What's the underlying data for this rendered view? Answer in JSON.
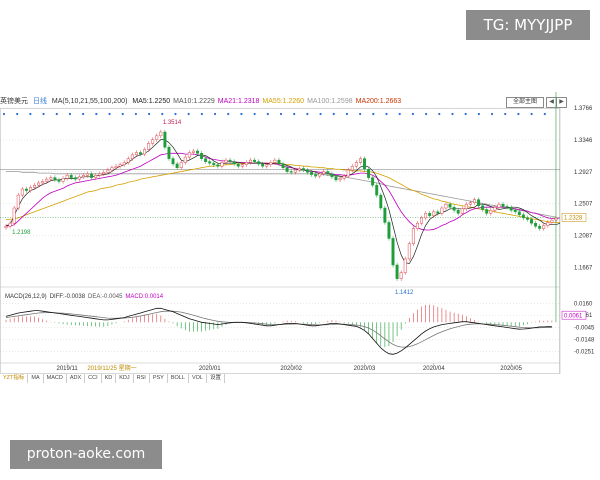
{
  "watermarks": {
    "top_right": "TG: MYYJJPP",
    "bottom_left": "proton-aoke.com"
  },
  "header": {
    "symbol": "英镑美元",
    "period": "日线",
    "ma_params": "MA(5,10,21,55,100,200)",
    "ma_values": [
      {
        "label": "MA5:1.2250",
        "color": "#222222"
      },
      {
        "label": "MA10:1.2229",
        "color": "#555555"
      },
      {
        "label": "MA21:1.2318",
        "color": "#c000c0"
      },
      {
        "label": "MA55:1.2260",
        "color": "#d4a000"
      },
      {
        "label": "MA100:1.2598",
        "color": "#999999"
      },
      {
        "label": "MA200:1.2663",
        "color": "#cc3300"
      }
    ],
    "zoom_label": "全部主图"
  },
  "macd_header": {
    "params": "MACD(26,12,9)",
    "diff": "DIFF:-0.0038",
    "dea": "DEA:-0.0045",
    "macd": "MACD:0.0014"
  },
  "colors": {
    "up": "#e0454b",
    "down": "#1e9e3a",
    "grid": "#c8c8c8",
    "ma5": "#222222",
    "ma21": "#c000c0",
    "ma55": "#d4a000",
    "ma100": "#999999",
    "ma200": "#cc3300"
  },
  "tabs": [
    "YZT指标",
    "MA",
    "MACD",
    "ADX",
    "CCI",
    "KD",
    "KDJ",
    "RSI",
    "PSY",
    "BOLL",
    "VOL",
    "设置"
  ],
  "chart_data": {
    "type": "candlestick",
    "price_axis_ticks": [
      "1.3766",
      "1.3346",
      "1.2927",
      "1.2507",
      "1.2087",
      "1.1667"
    ],
    "price_range": [
      1.145,
      1.3766
    ],
    "current_price_label": "1.2328",
    "current_price": 1.2328,
    "annotations": [
      {
        "text": "1.3514",
        "value": 1.3514,
        "index": 38
      },
      {
        "text": "1.2198",
        "value": 1.2198,
        "index": 1
      },
      {
        "text": "1.1412",
        "value": 1.1412,
        "index": 95
      }
    ],
    "x_labels": [
      "2019/11",
      "2020/01",
      "2020/02",
      "2020/03",
      "2020/04",
      "2020/05"
    ],
    "x_label_index": [
      15,
      50,
      70,
      88,
      105,
      124
    ],
    "crosshair_label": "2019/11/25 星期一",
    "closes": [
      1.221,
      1.225,
      1.245,
      1.262,
      1.27,
      1.268,
      1.272,
      1.275,
      1.278,
      1.28,
      1.283,
      1.285,
      1.282,
      1.28,
      1.284,
      1.288,
      1.285,
      1.283,
      1.286,
      1.288,
      1.29,
      1.285,
      1.288,
      1.29,
      1.292,
      1.295,
      1.298,
      1.3,
      1.302,
      1.305,
      1.31,
      1.315,
      1.318,
      1.316,
      1.322,
      1.33,
      1.335,
      1.34,
      1.345,
      1.325,
      1.31,
      1.303,
      1.298,
      1.305,
      1.312,
      1.318,
      1.32,
      1.317,
      1.31,
      1.306,
      1.304,
      1.302,
      1.3,
      1.305,
      1.308,
      1.306,
      1.303,
      1.3,
      1.302,
      1.305,
      1.308,
      1.306,
      1.303,
      1.3,
      1.302,
      1.305,
      1.308,
      1.303,
      1.298,
      1.293,
      1.292,
      1.295,
      1.297,
      1.295,
      1.292,
      1.289,
      1.287,
      1.29,
      1.293,
      1.29,
      1.286,
      1.282,
      1.284,
      1.287,
      1.295,
      1.3,
      1.305,
      1.31,
      1.296,
      1.285,
      1.275,
      1.262,
      1.245,
      1.226,
      1.205,
      1.17,
      1.152,
      1.16,
      1.178,
      1.198,
      1.218,
      1.225,
      1.232,
      1.238,
      1.235,
      1.24,
      1.238,
      1.245,
      1.25,
      1.246,
      1.242,
      1.238,
      1.244,
      1.25,
      1.252,
      1.256,
      1.248,
      1.243,
      1.238,
      1.242,
      1.246,
      1.25,
      1.247,
      1.246,
      1.242,
      1.24,
      1.236,
      1.232,
      1.23,
      1.225,
      1.221,
      1.218,
      1.222,
      1.226,
      1.229,
      1.232
    ],
    "ma5": [
      1.222,
      1.223,
      1.235,
      1.247,
      1.257,
      1.263,
      1.268,
      1.27,
      1.273,
      1.276,
      1.278,
      1.281,
      1.282,
      1.282,
      1.283,
      1.284,
      1.284,
      1.284,
      1.285,
      1.286,
      1.286,
      1.286,
      1.287,
      1.288,
      1.289,
      1.29,
      1.293,
      1.297,
      1.3,
      1.302,
      1.305,
      1.309,
      1.313,
      1.315,
      1.317,
      1.32,
      1.325,
      1.33,
      1.335,
      1.335,
      1.331,
      1.325,
      1.317,
      1.308,
      1.306,
      1.308,
      1.311,
      1.314,
      1.315,
      1.314,
      1.311,
      1.307,
      1.304,
      1.303,
      1.304,
      1.304,
      1.304,
      1.305,
      1.304,
      1.304,
      1.304,
      1.304,
      1.305,
      1.304,
      1.303,
      1.303,
      1.304,
      1.304,
      1.303,
      1.301,
      1.299,
      1.296,
      1.295,
      1.295,
      1.294,
      1.294,
      1.292,
      1.29,
      1.29,
      1.29,
      1.289,
      1.288,
      1.287,
      1.286,
      1.288,
      1.29,
      1.294,
      1.299,
      1.301,
      1.299,
      1.294,
      1.286,
      1.273,
      1.259,
      1.243,
      1.222,
      1.2,
      1.183,
      1.173,
      1.172,
      1.181,
      1.195,
      1.21,
      1.222,
      1.23,
      1.234,
      1.237,
      1.239,
      1.241,
      1.244,
      1.244,
      1.244,
      1.244,
      1.244,
      1.245,
      1.246,
      1.25,
      1.25,
      1.249,
      1.247,
      1.245,
      1.243,
      1.244,
      1.245,
      1.246,
      1.246,
      1.245,
      1.243,
      1.239,
      1.235,
      1.232,
      1.229,
      1.225,
      1.223,
      1.223,
      1.223,
      1.225
    ],
    "ma21": [
      1.222,
      1.221,
      1.223,
      1.228,
      1.233,
      1.238,
      1.243,
      1.248,
      1.253,
      1.258,
      1.262,
      1.265,
      1.267,
      1.269,
      1.271,
      1.274,
      1.276,
      1.278,
      1.279,
      1.28,
      1.281,
      1.282,
      1.283,
      1.284,
      1.285,
      1.286,
      1.287,
      1.288,
      1.29,
      1.292,
      1.294,
      1.296,
      1.298,
      1.3,
      1.303,
      1.306,
      1.309,
      1.312,
      1.315,
      1.316,
      1.317,
      1.317,
      1.317,
      1.317,
      1.316,
      1.316,
      1.316,
      1.315,
      1.314,
      1.312,
      1.31,
      1.309,
      1.308,
      1.307,
      1.307,
      1.306,
      1.306,
      1.305,
      1.305,
      1.305,
      1.304,
      1.304,
      1.304,
      1.304,
      1.304,
      1.303,
      1.303,
      1.302,
      1.3,
      1.299,
      1.298,
      1.297,
      1.296,
      1.295,
      1.294,
      1.293,
      1.293,
      1.292,
      1.292,
      1.291,
      1.29,
      1.289,
      1.289,
      1.288,
      1.288,
      1.289,
      1.29,
      1.291,
      1.291,
      1.29,
      1.288,
      1.285,
      1.28,
      1.275,
      1.268,
      1.259,
      1.249,
      1.24,
      1.233,
      1.227,
      1.222,
      1.219,
      1.217,
      1.216,
      1.216,
      1.217,
      1.219,
      1.222,
      1.224,
      1.227,
      1.229,
      1.232,
      1.236,
      1.239,
      1.242,
      1.244,
      1.245,
      1.246,
      1.246,
      1.246,
      1.246,
      1.246,
      1.246,
      1.246,
      1.245,
      1.244,
      1.243,
      1.242,
      1.241,
      1.239,
      1.238,
      1.236,
      1.234,
      1.232,
      1.231,
      1.231,
      1.232
    ],
    "ma55": [
      1.23,
      1.23,
      1.231,
      1.232,
      1.234,
      1.236,
      1.238,
      1.24,
      1.242,
      1.244,
      1.246,
      1.248,
      1.25,
      1.252,
      1.254,
      1.256,
      1.258,
      1.26,
      1.262,
      1.264,
      1.266,
      1.267,
      1.268,
      1.27,
      1.271,
      1.272,
      1.273,
      1.275,
      1.276,
      1.277,
      1.279,
      1.28,
      1.281,
      1.283,
      1.284,
      1.285,
      1.286,
      1.287,
      1.288,
      1.289,
      1.29,
      1.291,
      1.292,
      1.293,
      1.294,
      1.295,
      1.296,
      1.297,
      1.298,
      1.299,
      1.3,
      1.3,
      1.301,
      1.301,
      1.302,
      1.302,
      1.303,
      1.303,
      1.303,
      1.304,
      1.304,
      1.304,
      1.304,
      1.304,
      1.304,
      1.304,
      1.304,
      1.303,
      1.303,
      1.302,
      1.302,
      1.301,
      1.301,
      1.3,
      1.3,
      1.299,
      1.299,
      1.298,
      1.298,
      1.297,
      1.297,
      1.296,
      1.296,
      1.295,
      1.295,
      1.294,
      1.294,
      1.294,
      1.293,
      1.293,
      1.292,
      1.291,
      1.289,
      1.287,
      1.285,
      1.282,
      1.279,
      1.276,
      1.273,
      1.27,
      1.268,
      1.266,
      1.263,
      1.261,
      1.259,
      1.257,
      1.256,
      1.254,
      1.253,
      1.251,
      1.25,
      1.249,
      1.248,
      1.247,
      1.246,
      1.245,
      1.244,
      1.243,
      1.242,
      1.241,
      1.24,
      1.239,
      1.238,
      1.237,
      1.236,
      1.235,
      1.234,
      1.233,
      1.232,
      1.231,
      1.23,
      1.229,
      1.228,
      1.227,
      1.226,
      1.226,
      1.226
    ],
    "ma200": [
      1.293,
      1.293,
      1.293,
      1.293,
      1.292,
      1.292,
      1.292,
      1.292,
      1.291,
      1.291,
      1.291,
      1.291,
      1.29,
      1.29,
      1.29,
      1.29,
      1.29,
      1.29,
      1.29,
      1.29,
      1.29,
      1.29,
      1.29,
      1.29,
      1.29,
      1.29,
      1.29,
      1.29,
      1.29,
      1.29,
      1.29,
      1.29,
      1.29,
      1.29,
      1.29,
      1.29,
      1.29,
      1.29,
      1.29,
      1.29,
      1.29,
      1.29,
      1.29,
      1.29,
      1.29,
      1.29,
      1.29,
      1.29,
      1.29,
      1.29,
      1.29,
      1.29,
      1.29,
      1.29,
      1.29,
      1.29,
      1.29,
      1.29,
      1.29,
      1.29,
      1.29,
      1.29,
      1.29,
      1.29,
      1.29,
      1.29,
      1.29,
      1.29,
      1.29,
      1.29,
      1.29,
      1.29,
      1.29,
      1.29,
      1.29,
      1.29,
      1.29,
      1.289,
      1.289,
      1.288,
      1.288,
      1.287,
      1.286,
      1.285,
      1.285,
      1.284,
      1.283,
      1.282,
      1.281,
      1.28,
      1.279,
      1.278,
      1.277,
      1.275,
      1.274,
      1.273,
      1.272,
      1.271,
      1.27,
      1.269,
      1.268,
      1.267,
      1.266,
      1.265,
      1.264,
      1.263,
      1.262,
      1.261,
      1.26,
      1.259,
      1.258,
      1.257,
      1.256,
      1.255,
      1.254,
      1.253,
      1.252,
      1.251,
      1.25,
      1.249,
      1.248,
      1.247,
      1.246,
      1.245,
      1.244,
      1.243,
      1.242,
      1.241,
      1.24,
      1.239,
      1.238,
      1.237,
      1.236,
      1.235,
      1.234,
      1.233
    ],
    "macd_axis_ticks": [
      "0.0160",
      "0.0061",
      "-0.0045",
      "-0.0148",
      "-0.0251"
    ],
    "macd_range": [
      -0.029,
      0.02
    ],
    "macd_current_label": "0.0061",
    "macd_current": 0.0061,
    "diff": [
      0.005,
      0.006,
      0.007,
      0.008,
      0.0085,
      0.009,
      0.0095,
      0.01,
      0.01,
      0.0095,
      0.009,
      0.0085,
      0.008,
      0.0075,
      0.007,
      0.0065,
      0.006,
      0.0055,
      0.005,
      0.0045,
      0.004,
      0.0035,
      0.003,
      0.0025,
      0.002,
      0.002,
      0.0025,
      0.003,
      0.0035,
      0.004,
      0.005,
      0.006,
      0.007,
      0.008,
      0.009,
      0.01,
      0.011,
      0.012,
      0.012,
      0.011,
      0.01,
      0.009,
      0.0075,
      0.006,
      0.0045,
      0.003,
      0.002,
      0.001,
      0.0,
      -0.0005,
      -0.001,
      -0.0015,
      -0.002,
      -0.0015,
      -0.001,
      -0.0005,
      0.0,
      0.0,
      0.0,
      -0.0005,
      -0.001,
      -0.0015,
      -0.002,
      -0.0025,
      -0.003,
      -0.003,
      -0.0025,
      -0.002,
      -0.0015,
      -0.001,
      -0.001,
      -0.001,
      -0.0015,
      -0.002,
      -0.0025,
      -0.003,
      -0.003,
      -0.0025,
      -0.002,
      -0.0015,
      -0.001,
      -0.001,
      -0.0015,
      -0.002,
      -0.0025,
      -0.003,
      -0.0035,
      -0.005,
      -0.007,
      -0.01,
      -0.014,
      -0.018,
      -0.022,
      -0.025,
      -0.027,
      -0.0275,
      -0.0265,
      -0.0245,
      -0.022,
      -0.019,
      -0.016,
      -0.013,
      -0.01,
      -0.0075,
      -0.0055,
      -0.004,
      -0.003,
      -0.002,
      -0.0015,
      -0.001,
      -0.0005,
      0.0,
      0.0005,
      0.0005,
      0.0,
      -0.0005,
      -0.001,
      -0.0015,
      -0.002,
      -0.0025,
      -0.003,
      -0.0035,
      -0.004,
      -0.0045,
      -0.005,
      -0.0055,
      -0.006,
      -0.0058,
      -0.0055,
      -0.005,
      -0.0045,
      -0.004,
      -0.004,
      -0.0038,
      -0.0038
    ],
    "dea": [
      0.004,
      0.0045,
      0.005,
      0.0055,
      0.006,
      0.0065,
      0.007,
      0.0075,
      0.008,
      0.0082,
      0.0083,
      0.0083,
      0.0082,
      0.008,
      0.0078,
      0.0075,
      0.0072,
      0.0068,
      0.0064,
      0.006,
      0.0056,
      0.0052,
      0.0048,
      0.0044,
      0.004,
      0.0036,
      0.0034,
      0.0034,
      0.0035,
      0.0036,
      0.0039,
      0.0043,
      0.0048,
      0.0054,
      0.0061,
      0.0068,
      0.0076,
      0.0084,
      0.0091,
      0.0095,
      0.0096,
      0.0095,
      0.0092,
      0.0087,
      0.0079,
      0.007,
      0.006,
      0.005,
      0.004,
      0.0031,
      0.0023,
      0.0015,
      0.0008,
      0.0004,
      0.0001,
      -0.0001,
      -0.0001,
      -0.0001,
      -0.0001,
      -0.0002,
      -0.0004,
      -0.0006,
      -0.0009,
      -0.0012,
      -0.0016,
      -0.0019,
      -0.002,
      -0.002,
      -0.0019,
      -0.0017,
      -0.0016,
      -0.0015,
      -0.0015,
      -0.0016,
      -0.0018,
      -0.002,
      -0.0022,
      -0.0023,
      -0.0022,
      -0.0021,
      -0.0019,
      -0.0017,
      -0.0017,
      -0.0017,
      -0.0019,
      -0.0021,
      -0.0024,
      -0.0029,
      -0.0037,
      -0.005,
      -0.0068,
      -0.009,
      -0.0116,
      -0.0143,
      -0.0168,
      -0.019,
      -0.0205,
      -0.0213,
      -0.0214,
      -0.0209,
      -0.0199,
      -0.0185,
      -0.0168,
      -0.015,
      -0.0131,
      -0.0113,
      -0.0096,
      -0.0081,
      -0.0068,
      -0.0056,
      -0.0046,
      -0.0037,
      -0.0028,
      -0.0021,
      -0.0017,
      -0.0014,
      -0.0013,
      -0.0014,
      -0.0015,
      -0.0017,
      -0.002,
      -0.0023,
      -0.0026,
      -0.003,
      -0.0034,
      -0.0038,
      -0.0042,
      -0.0045,
      -0.0047,
      -0.0048,
      -0.0048,
      -0.0047,
      -0.0046,
      -0.0045,
      -0.0045
    ],
    "blue_dots_count": 14
  }
}
